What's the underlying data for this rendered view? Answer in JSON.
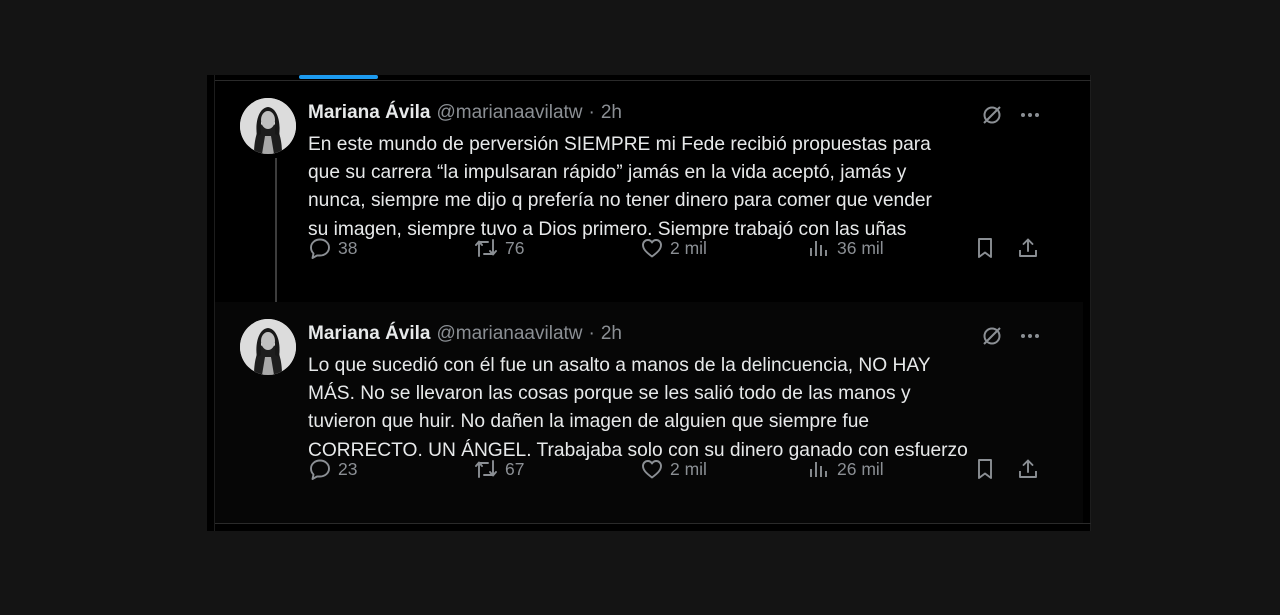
{
  "tweets": [
    {
      "author": "Mariana Ávila",
      "handle": "@marianaavilatw",
      "separator": "·",
      "time": "2h",
      "lines": [
        "En este mundo de perversión SIEMPRE mi Fede recibió propuestas para",
        "que su carrera “la impulsaran rápido” jamás en la vida aceptó, jamás y",
        "nunca, siempre me dijo q prefería no tener dinero para comer que vender",
        "su imagen, siempre tuvo a Dios primero. Siempre trabajó con las uñas"
      ],
      "stats": {
        "replies": "38",
        "reposts": "76",
        "likes": "2 mil",
        "views": "36 mil"
      }
    },
    {
      "author": "Mariana Ávila",
      "handle": "@marianaavilatw",
      "separator": "·",
      "time": "2h",
      "lines": [
        "Lo que sucedió con él fue un asalto a manos de la delincuencia, NO HAY",
        "MÁS. No se llevaron las cosas porque se les salió todo de las manos y",
        "tuvieron que huir. No dañen la imagen de alguien que siempre fue",
        "CORRECTO. UN ÁNGEL. Trabajaba solo con su dinero ganado con esfuerzo"
      ],
      "stats": {
        "replies": "23",
        "reposts": "67",
        "likes": "2 mil",
        "views": "26 mil"
      }
    }
  ],
  "icons": {
    "grok": "grok-slash-circle-icon",
    "more": "more-dots-icon",
    "reply": "reply-bubble-icon",
    "repost": "repost-arrows-icon",
    "like": "heart-icon",
    "views": "views-bars-icon",
    "bookmark": "bookmark-icon",
    "share": "share-upload-icon"
  },
  "colors": {
    "background": "#000000",
    "text": "#e7e9ea",
    "muted": "#8b8f94",
    "accent": "#1d9bf0"
  }
}
